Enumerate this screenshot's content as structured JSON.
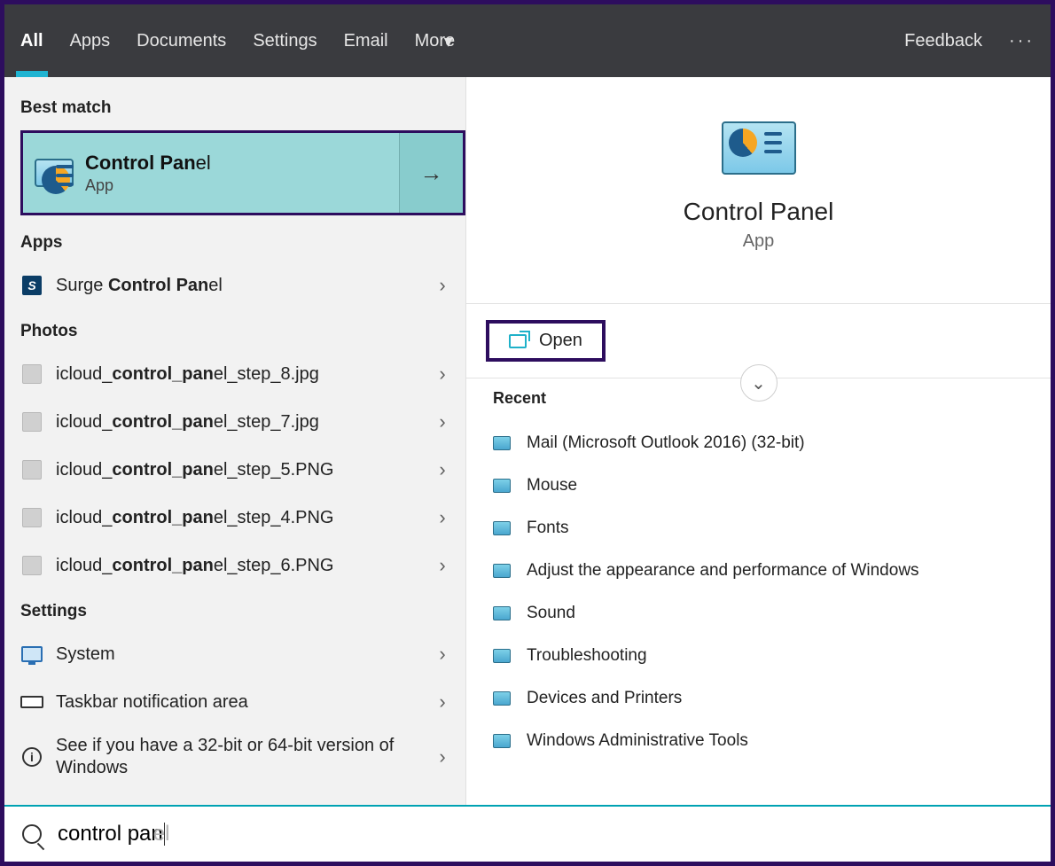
{
  "tabs": {
    "all": "All",
    "apps": "Apps",
    "documents": "Documents",
    "settings": "Settings",
    "email": "Email",
    "more": "More",
    "feedback": "Feedback"
  },
  "search": {
    "typed": "control pan",
    "ghost_suffix": "el"
  },
  "left": {
    "best_match_heading": "Best match",
    "best_match_title_bold": "Control Pan",
    "best_match_title_rest": "el",
    "best_match_sub": "App",
    "apps_heading": "Apps",
    "apps": [
      {
        "pre": "Surge ",
        "bold": "Control Pan",
        "post": "el"
      }
    ],
    "photos_heading": "Photos",
    "photos": [
      {
        "pre": "icloud_",
        "bold": "control_pan",
        "post": "el_step_8.jpg"
      },
      {
        "pre": "icloud_",
        "bold": "control_pan",
        "post": "el_step_7.jpg"
      },
      {
        "pre": "icloud_",
        "bold": "control_pan",
        "post": "el_step_5.PNG"
      },
      {
        "pre": "icloud_",
        "bold": "control_pan",
        "post": "el_step_4.PNG"
      },
      {
        "pre": "icloud_",
        "bold": "control_pan",
        "post": "el_step_6.PNG"
      }
    ],
    "settings_heading": "Settings",
    "settings": [
      {
        "label": "System",
        "icon": "monitor"
      },
      {
        "label": "Taskbar notification area",
        "icon": "rect"
      },
      {
        "label": "See if you have a 32-bit or 64-bit version of Windows",
        "icon": "info"
      }
    ]
  },
  "preview": {
    "title": "Control Panel",
    "sub": "App",
    "open_label": "Open",
    "recent_heading": "Recent",
    "recent": [
      "Mail (Microsoft Outlook 2016) (32-bit)",
      "Mouse",
      "Fonts",
      "Adjust the appearance and performance of Windows",
      "Sound",
      "Troubleshooting",
      "Devices and Printers",
      "Windows Administrative Tools"
    ]
  }
}
